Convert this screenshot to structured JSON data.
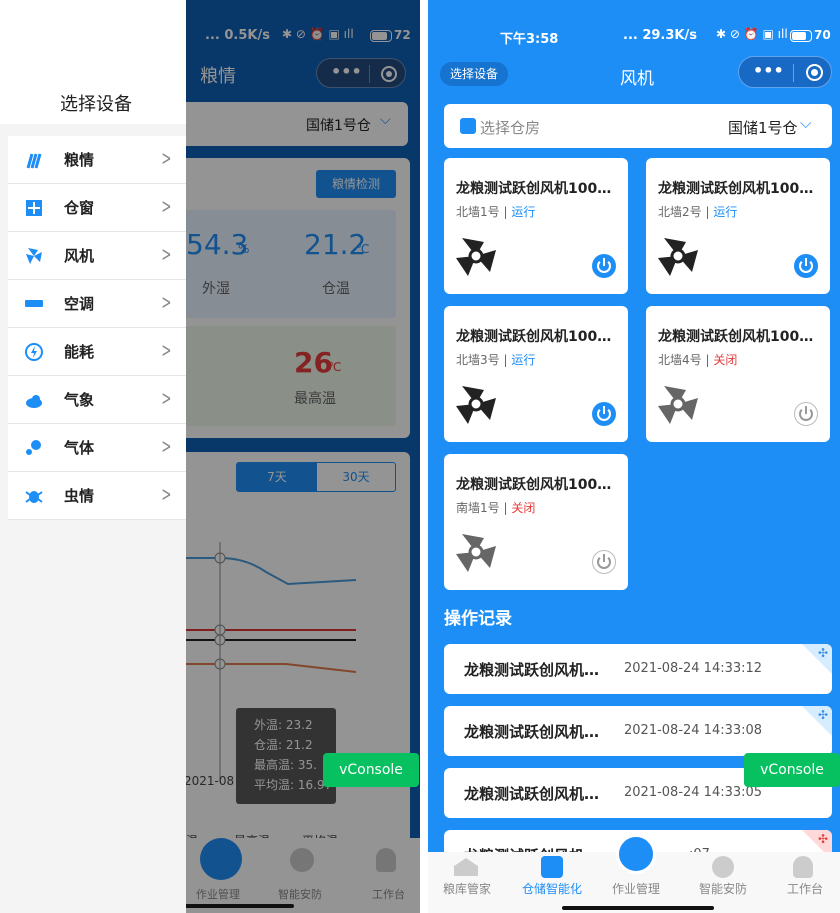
{
  "left": {
    "status": {
      "speed": "... 0.5K/s",
      "battery": "72"
    },
    "page_title": "粮情",
    "warehouse": "国储1号仓",
    "grain_check": "粮情检测",
    "stats": {
      "humidity_value": "54.3",
      "humidity_unit": "%",
      "humidity_label": "外湿",
      "temp_value": "21.2",
      "temp_unit": "℃",
      "temp_label": "仓温",
      "max_value": "26",
      "max_unit": "℃",
      "max_label": "最高温"
    },
    "ranges": [
      "7天",
      "30天"
    ],
    "chart": {
      "date": "2021-08",
      "legend": [
        "外温: 23.2",
        "仓温: 21.2",
        "最高温: 35.",
        "平均温: 16.97"
      ],
      "bottom_legend": [
        "温",
        "最高温",
        "平均温"
      ]
    },
    "drawer": {
      "title": "选择设备",
      "items": [
        "粮情",
        "仓窗",
        "风机",
        "空调",
        "能耗",
        "气象",
        "气体",
        "虫情"
      ]
    },
    "vconsole": "vConsole",
    "tabs": [
      "作业管理",
      "智能安防",
      "工作台"
    ]
  },
  "right": {
    "status": {
      "time": "下午3:58",
      "speed": "... 29.3K/s",
      "battery": "70"
    },
    "select_device": "选择设备",
    "page_title": "风机",
    "select_warehouse": "选择仓房",
    "warehouse": "国储1号仓",
    "fans": [
      {
        "name": "龙粮测试跃创风机100…",
        "location": "北墙1号",
        "state": "运行",
        "on": true
      },
      {
        "name": "龙粮测试跃创风机100…",
        "location": "北墙2号",
        "state": "运行",
        "on": true
      },
      {
        "name": "龙粮测试跃创风机100…",
        "location": "北墙3号",
        "state": "运行",
        "on": true
      },
      {
        "name": "龙粮测试跃创风机100…",
        "location": "北墙4号",
        "state": "关闭",
        "on": false
      },
      {
        "name": "龙粮测试跃创风机100…",
        "location": "南墙1号",
        "state": "关闭",
        "on": false
      }
    ],
    "records_title": "操作记录",
    "records": [
      {
        "name": "龙粮测试跃创风机…",
        "time": "2021-08-24 14:33:12"
      },
      {
        "name": "龙粮测试跃创风机…",
        "time": "2021-08-24 14:33:08"
      },
      {
        "name": "龙粮测试跃创风机…",
        "time": "2021-08-24 14:33:05"
      },
      {
        "name": "龙粮测试跃创风机…",
        "time": "…:07"
      }
    ],
    "vconsole": "vConsole",
    "tabs": [
      "粮库管家",
      "仓储智能化",
      "作业管理",
      "智能安防",
      "工作台"
    ],
    "colors": {
      "blue": "#1e8ef7",
      "running": "#1e8ef7",
      "off": "#e63c3c",
      "active_tab": "#1e8ef7"
    }
  }
}
